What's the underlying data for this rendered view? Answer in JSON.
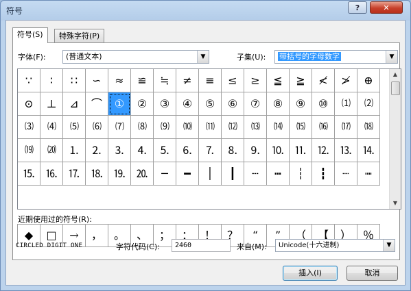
{
  "window": {
    "title": "符号",
    "help_label": "?",
    "close_label": "✕"
  },
  "tabs": [
    {
      "label": "符号(S)",
      "active": true
    },
    {
      "label": "特殊字符(P)",
      "active": false
    }
  ],
  "font": {
    "label": "字体(F):",
    "value": "(普通文本)"
  },
  "subset": {
    "label": "子集(U):",
    "value": "带括号的字母数字"
  },
  "symbols": [
    "∵",
    "∶",
    "∷",
    "∽",
    "≈",
    "≌",
    "≒",
    "≠",
    "≡",
    "≤",
    "≥",
    "≦",
    "≧",
    "≮",
    "≯",
    "⊕",
    "⊙",
    "⊥",
    "⊿",
    "⌒",
    "①",
    "②",
    "③",
    "④",
    "⑤",
    "⑥",
    "⑦",
    "⑧",
    "⑨",
    "⑩",
    "⑴",
    "⑵",
    "⑶",
    "⑷",
    "⑸",
    "⑹",
    "⑺",
    "⑻",
    "⑼",
    "⑽",
    "⑾",
    "⑿",
    "⒀",
    "⒁",
    "⒂",
    "⒃",
    "⒄",
    "⒅",
    "⒆",
    "⒇",
    "⒈",
    "⒉",
    "⒊",
    "⒋",
    "⒌",
    "⒍",
    "⒎",
    "⒏",
    "⒐",
    "⒑",
    "⒒",
    "⒓",
    "⒔",
    "⒕",
    "⒖",
    "⒗",
    "⒘",
    "⒙",
    "⒚",
    "⒛",
    "─",
    "━",
    "│",
    "┃",
    "┄",
    "┅",
    "┆",
    "┇",
    "┈",
    "┉"
  ],
  "selected_symbol": "①",
  "recent": {
    "label": "近期使用过的符号(R):",
    "items": [
      "◆",
      "□",
      "→",
      "，",
      "。",
      "、",
      "；",
      "：",
      "！",
      "？",
      "“",
      "”",
      "（",
      "【",
      "）",
      "％"
    ]
  },
  "char_name": "CIRCLED DIGIT ONE",
  "char_code": {
    "label": "字符代码(C):",
    "value": "2460"
  },
  "from": {
    "label": "来自(M):",
    "value": "Unicode(十六进制)"
  },
  "buttons": {
    "insert": "插入(I)",
    "cancel": "取消"
  }
}
